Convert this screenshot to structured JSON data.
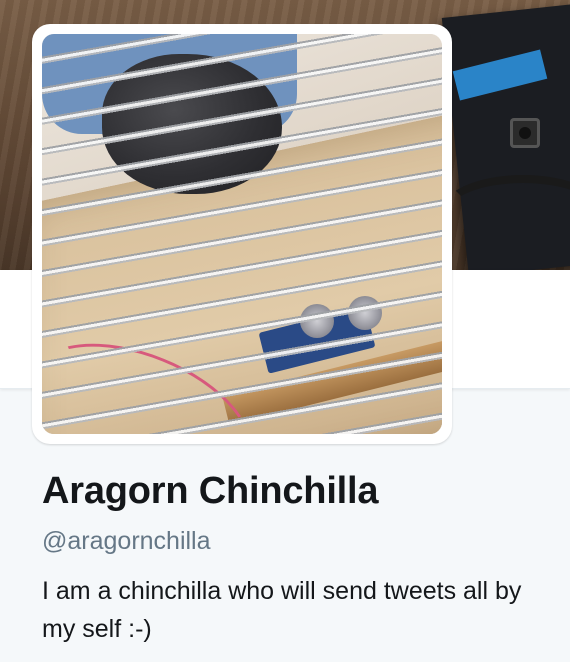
{
  "profile": {
    "display_name": "Aragorn Chinchilla",
    "handle": "@aragornchilla",
    "bio": "I am a chinchilla who will send tweets all by my self :-)"
  },
  "colors": {
    "page_background": "#f5f8fa",
    "name_text": "#14171a",
    "handle_text": "#657786"
  }
}
